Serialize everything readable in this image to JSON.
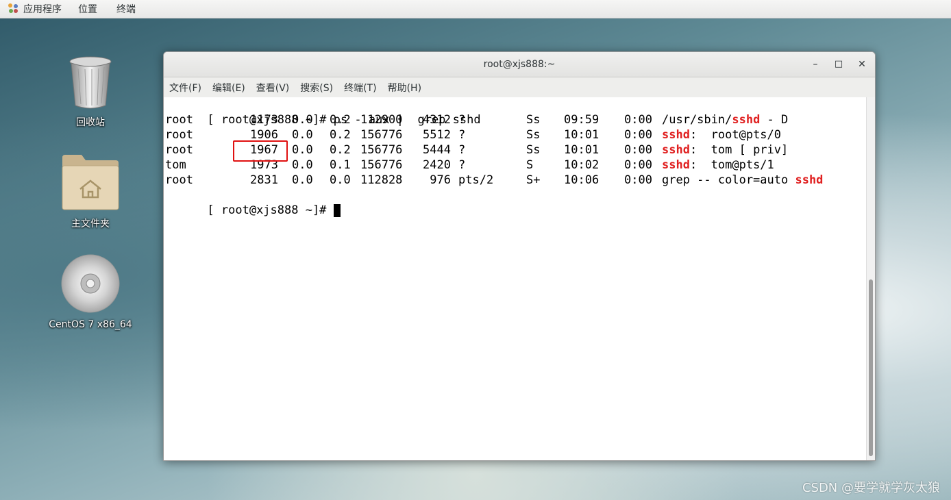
{
  "top_panel": {
    "applications": "应用程序",
    "places": "位置",
    "terminal": "终端"
  },
  "desktop": {
    "trash": "回收站",
    "home": "主文件夹",
    "disc": "CentOS 7 x86_64"
  },
  "window": {
    "title": "root@xjs888:~",
    "minimize": "–",
    "maximize": "□",
    "close": "✕",
    "menu": [
      "文件(F)",
      "编辑(E)",
      "查看(V)",
      "搜索(S)",
      "终端(T)",
      "帮助(H)"
    ]
  },
  "terminal": {
    "prompt": "[ root@xjs888 ~]# ",
    "command": "ps - aux |  grep sshd",
    "rows": [
      {
        "user": "root",
        "pid": "1173",
        "cpu": "0.0",
        "mem": "0.2",
        "vsz": "112900",
        "rss": "4312",
        "tty": "?",
        "stat": "Ss",
        "start": "09:59",
        "time": "0:00",
        "cmd_pre": "/usr/sbin/",
        "cmd_hl": "sshd",
        "cmd_post": " - D"
      },
      {
        "user": "root",
        "pid": "1906",
        "cpu": "0.0",
        "mem": "0.2",
        "vsz": "156776",
        "rss": "5512",
        "tty": "?",
        "stat": "Ss",
        "start": "10:01",
        "time": "0:00",
        "cmd_pre": "",
        "cmd_hl": "sshd",
        "cmd_post": ":  root@pts/0"
      },
      {
        "user": "root",
        "pid": "1967",
        "cpu": "0.0",
        "mem": "0.2",
        "vsz": "156776",
        "rss": "5444",
        "tty": "?",
        "stat": "Ss",
        "start": "10:01",
        "time": "0:00",
        "cmd_pre": "",
        "cmd_hl": "sshd",
        "cmd_post": ":  tom [ priv]"
      },
      {
        "user": "tom",
        "pid": "1973",
        "cpu": "0.0",
        "mem": "0.1",
        "vsz": "156776",
        "rss": "2420",
        "tty": "?",
        "stat": "S",
        "start": "10:02",
        "time": "0:00",
        "cmd_pre": "",
        "cmd_hl": "sshd",
        "cmd_post": ":  tom@pts/1"
      },
      {
        "user": "root",
        "pid": "2831",
        "cpu": "0.0",
        "mem": "0.0",
        "vsz": "112828",
        "rss": "976",
        "tty": "pts/2",
        "stat": "S+",
        "start": "10:06",
        "time": "0:00",
        "cmd_pre": "grep -- color=auto ",
        "cmd_hl": "sshd",
        "cmd_post": ""
      }
    ],
    "prompt2": "[ root@xjs888 ~]# "
  },
  "watermark": "CSDN @要学就学灰太狼",
  "colors": {
    "highlight": "#e02020",
    "box": "#e01010"
  }
}
